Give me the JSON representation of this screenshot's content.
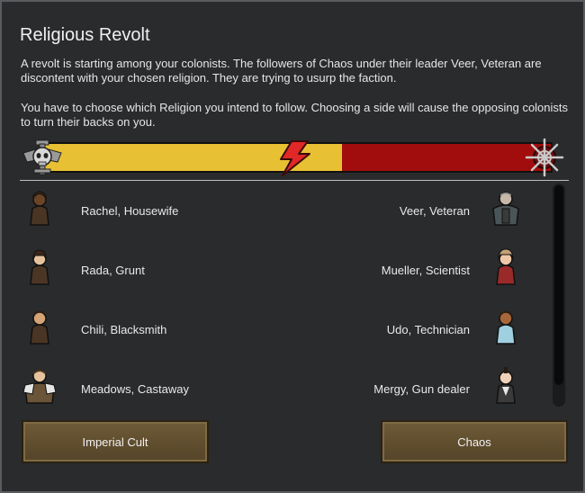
{
  "dialog": {
    "title": "Religious Revolt",
    "paragraph1": "A revolt is starting among your colonists. The followers of Chaos under their leader Veer, Veteran are discontent with your chosen religion. They are trying to usurp the faction.",
    "paragraph2": "You have to choose which Religion you intend to follow. Choosing a side will cause the opposing colonists to turn their backs on you."
  },
  "balance_bar": {
    "left_icon": "imperial-aquila-skull-icon",
    "center_icon": "lightning-bolt-icon",
    "right_icon": "chaos-star-icon",
    "left_fraction": 0.54,
    "colors": {
      "left": "#e8c033",
      "right": "#a10d0d"
    }
  },
  "left_colonists": [
    {
      "label": "Rachel, Housewife",
      "skin": "#6b4426",
      "hair": "#3b2616",
      "shirt": "#4a3524"
    },
    {
      "label": "Rada, Grunt",
      "skin": "#e6c39c",
      "hair": "#3a2518",
      "shirt": "#4b3626"
    },
    {
      "label": "Chili, Blacksmith",
      "skin": "#d4a477",
      "hair": "#2f1f14",
      "shirt": "#4a3524"
    },
    {
      "label": "Meadows, Castaway",
      "skin": "#e6c39c",
      "hair": "#4a3524",
      "shirt": "#6b5538"
    }
  ],
  "right_colonists": [
    {
      "label": "Veer, Veteran",
      "skin": "#c8b8a8",
      "hair": "#8a8a8a",
      "shirt": "#4a5558"
    },
    {
      "label": "Mueller, Scientist",
      "skin": "#f0c8a8",
      "hair": "#c6a078",
      "shirt": "#9a2a2a"
    },
    {
      "label": "Udo, Technician",
      "skin": "#a8663a",
      "hair": "#2f1f14",
      "shirt": "#9ed0e0"
    },
    {
      "label": "Mergy, Gun dealer",
      "skin": "#f0d0b8",
      "hair": "#2a1a10",
      "shirt": "#3a3a3a"
    }
  ],
  "buttons": {
    "left": "Imperial Cult",
    "right": "Chaos"
  }
}
